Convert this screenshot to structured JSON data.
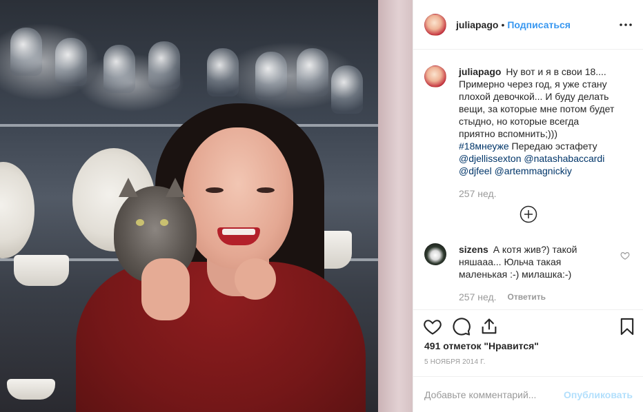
{
  "post": {
    "author": {
      "username": "juliapago",
      "follow_label": "Подписаться",
      "separator": "•"
    },
    "more_icon": "more-horizontal-icon",
    "caption": {
      "username": "juliapago",
      "text": "Ну вот и я в свои 18.... Примерно через год, я уже стану плохой девочкой... И буду делать вещи, за которые мне потом будет стыдно, но которые всегда приятно вспомнить;)))",
      "hashtag": "#18мнеуже",
      "text2": "Передаю эстафету",
      "mentions": [
        "@djellissexton",
        "@natashabaccardi",
        "@djfeel",
        "@artemmagnickiy"
      ],
      "age": "257 нед."
    },
    "load_more_icon": "plus-circle-icon",
    "comments": [
      {
        "username": "sizens",
        "text": "А котя жив?) такой няшааа... Юльча такая маленькая :-) милашка:-)",
        "age": "257 нед.",
        "reply_label": "Ответить",
        "like_icon": "heart-outline-icon"
      }
    ],
    "actions": {
      "like_icon": "heart-outline-icon",
      "comment_icon": "speech-bubble-icon",
      "share_icon": "share-upload-icon",
      "save_icon": "bookmark-icon"
    },
    "likes_text": "491 отметок \"Нравится\"",
    "date": "5 ноября 2014 г.",
    "add_comment": {
      "placeholder": "Добавьте комментарий...",
      "post_label": "Опубликовать"
    }
  }
}
